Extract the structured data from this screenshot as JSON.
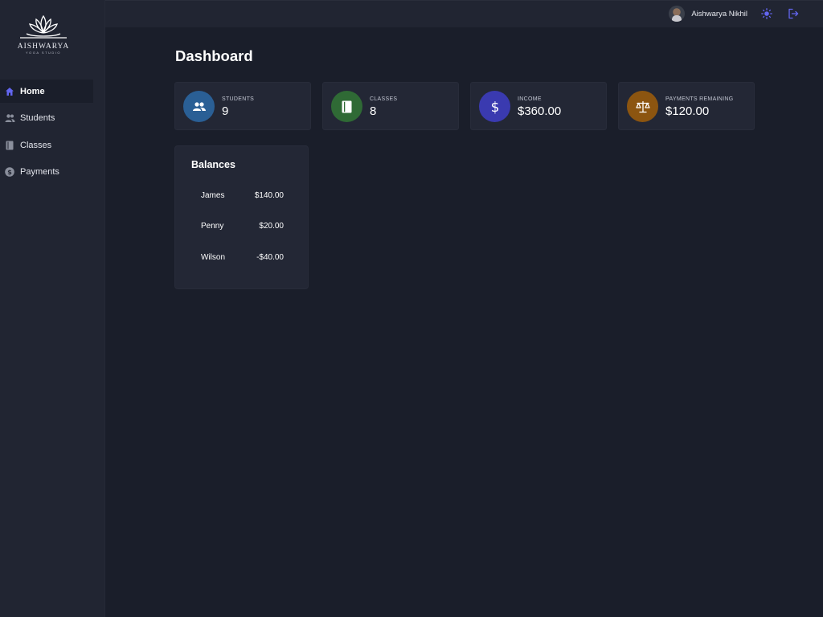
{
  "brand": {
    "name": "AISHWARYA",
    "tagline": "YOGA STUDIO"
  },
  "sidebar": {
    "items": [
      {
        "label": "Home",
        "icon": "home-icon"
      },
      {
        "label": "Students",
        "icon": "users-icon"
      },
      {
        "label": "Classes",
        "icon": "book-icon"
      },
      {
        "label": "Payments",
        "icon": "dollar-circle-icon"
      }
    ],
    "active": "Home"
  },
  "header": {
    "user_name": "Aishwarya Nikhil",
    "theme_icon": "sun-icon",
    "logout_icon": "logout-icon"
  },
  "main": {
    "title": "Dashboard",
    "stats": [
      {
        "label": "STUDENTS",
        "value": "9",
        "icon": "users-icon",
        "color": "#2a5f95"
      },
      {
        "label": "CLASSES",
        "value": "8",
        "icon": "book-icon",
        "color": "#2f6a35"
      },
      {
        "label": "INCOME",
        "value": "$360.00",
        "icon": "dollar-icon",
        "color": "#3a3ab0"
      },
      {
        "label": "PAYMENTS REMAINING",
        "value": "$120.00",
        "icon": "scale-icon",
        "color": "#8c5510"
      }
    ],
    "balances": {
      "title": "Balances",
      "rows": [
        {
          "name": "James",
          "amount": "$140.00"
        },
        {
          "name": "Penny",
          "amount": "$20.00"
        },
        {
          "name": "Wilson",
          "amount": "-$40.00"
        }
      ]
    }
  },
  "colors": {
    "accent": "#6366f1",
    "background": "#1a1e2a",
    "panel": "#212532"
  }
}
